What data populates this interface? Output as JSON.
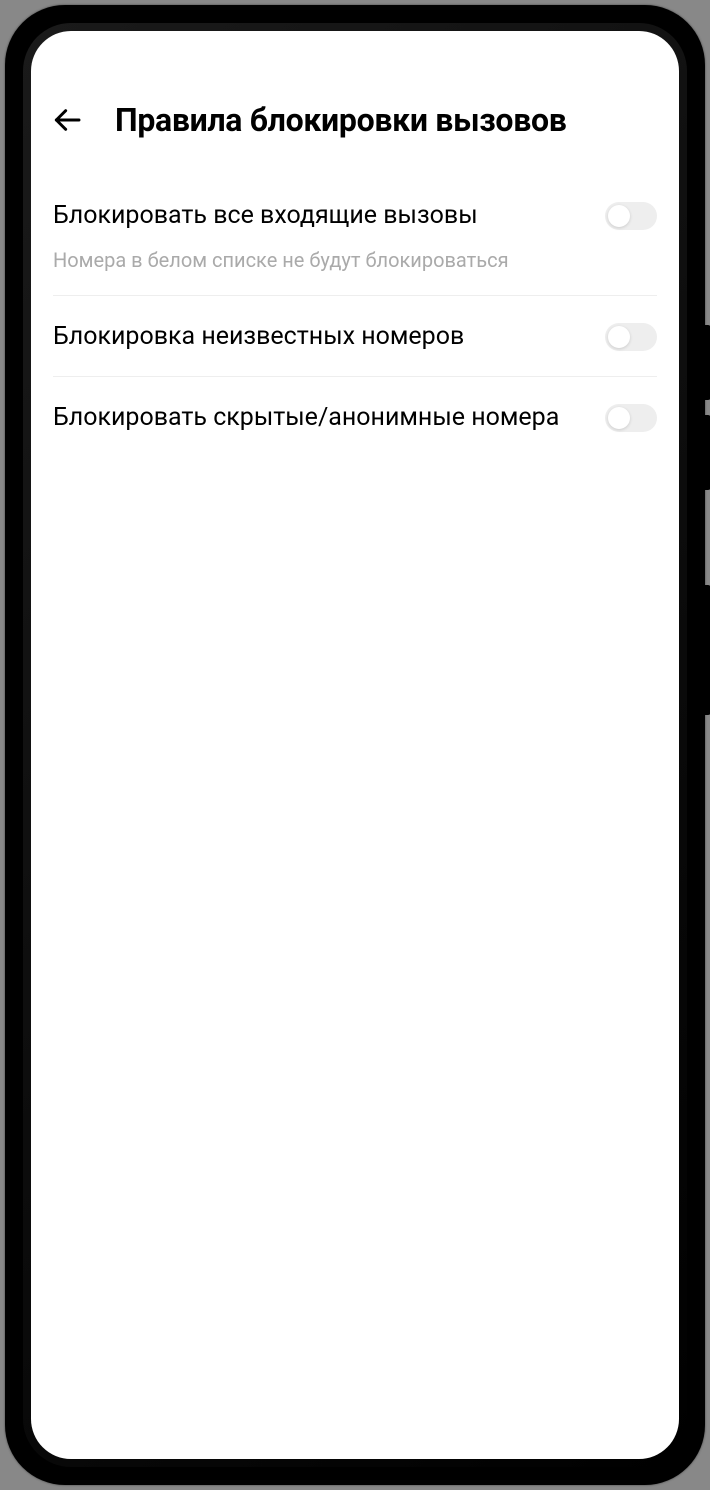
{
  "header": {
    "title": "Правила блокировки вызовов"
  },
  "settings": [
    {
      "label": "Блокировать все входящие вызовы",
      "subtext": "Номера в белом списке не будут блокироваться",
      "state": "off"
    },
    {
      "label": "Блокировка неизвестных номеров",
      "subtext": null,
      "state": "off"
    },
    {
      "label": "Блокировать скрытые/анонимные номера",
      "subtext": null,
      "state": "off"
    }
  ]
}
